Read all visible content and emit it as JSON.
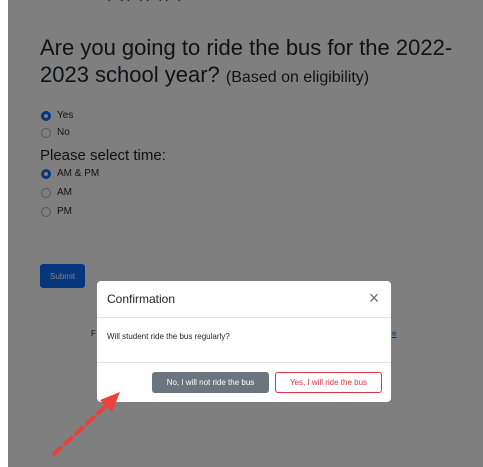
{
  "form": {
    "question_main": "Are you going to ride the bus for the 2022-2023 school year?",
    "question_note": "(Based on eligibility)",
    "ride_options": [
      {
        "label": "Yes",
        "checked": true
      },
      {
        "label": "No",
        "checked": false
      }
    ],
    "time_heading": "Please select time:",
    "time_options": [
      {
        "label": "AM & PM",
        "checked": true
      },
      {
        "label": "AM",
        "checked": false
      },
      {
        "label": "PM",
        "checked": false
      }
    ],
    "submit_label": "Submit",
    "fragment_left": "F",
    "fragment_right": "e"
  },
  "modal": {
    "title": "Confirmation",
    "close_glyph": "×",
    "body": "Will student ride the bus regularly?",
    "no_label": "No, I will not ride the bus",
    "yes_label": "Yes, I will ride the bus"
  },
  "colors": {
    "primary": "#0d6efd",
    "secondary": "#6c757d",
    "danger": "#dc3545",
    "arrow": "#e8423a"
  },
  "icons": {
    "close": "close-icon",
    "arrow": "arrow-icon"
  }
}
